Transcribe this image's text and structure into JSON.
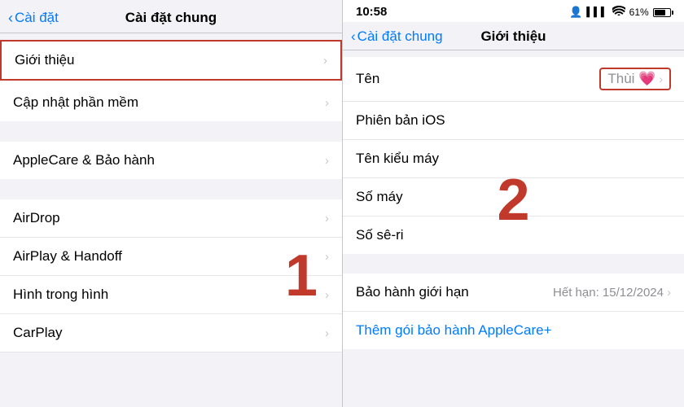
{
  "left": {
    "header": {
      "back_label": "Cài đặt",
      "title": "Cài đặt chung"
    },
    "items_group1": [
      {
        "label": "Giới thiệu",
        "highlighted": true
      },
      {
        "label": "Cập nhật phần mềm",
        "highlighted": false
      }
    ],
    "items_group2": [
      {
        "label": "AppleCare & Bảo hành",
        "highlighted": false
      }
    ],
    "items_group3": [
      {
        "label": "AirDrop",
        "highlighted": false
      },
      {
        "label": "AirPlay & Handoff",
        "highlighted": false
      },
      {
        "label": "Hình trong hình",
        "highlighted": false
      },
      {
        "label": "CarPlay",
        "highlighted": false
      }
    ],
    "big_number": "1"
  },
  "right": {
    "status_bar": {
      "time": "10:58",
      "person_icon": "👤",
      "signal": "▌▌▌",
      "wifi": "WiFi",
      "battery": "61%"
    },
    "header": {
      "back_label": "Cài đặt chung",
      "title": "Giới thiệu"
    },
    "info_items": [
      {
        "label": "Tên",
        "value": "Thùi 💗",
        "has_chevron": true,
        "highlighted": true
      },
      {
        "label": "Phiên bản iOS",
        "value": "",
        "has_chevron": false,
        "highlighted": false
      },
      {
        "label": "Tên kiểu máy",
        "value": "",
        "has_chevron": false,
        "highlighted": false
      },
      {
        "label": "Số máy",
        "value": "",
        "has_chevron": false,
        "highlighted": false
      },
      {
        "label": "Số sê-ri",
        "value": "",
        "has_chevron": false,
        "highlighted": false
      }
    ],
    "warranty": {
      "label": "Bảo hành giới hạn",
      "value": "Hết hạn: 15/12/2024",
      "has_chevron": true
    },
    "applecare_link": "Thêm gói bảo hành AppleCare+",
    "big_number": "2"
  }
}
